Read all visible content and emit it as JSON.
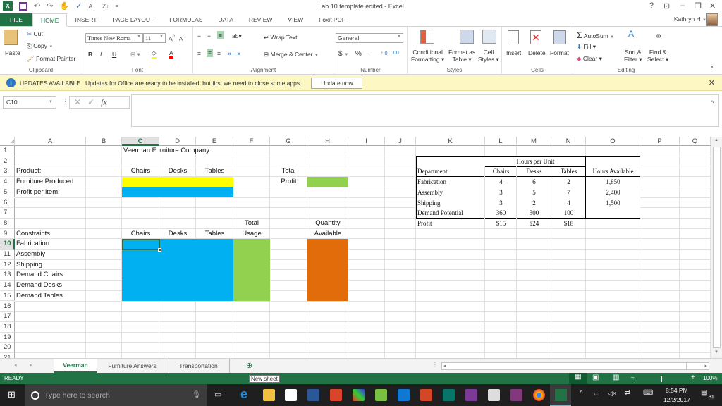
{
  "window": {
    "title": "Lab 10 template edited - Excel",
    "help": "?",
    "controls": [
      "ribbon-display-options",
      "minimize",
      "restore",
      "close"
    ]
  },
  "ribbon_tabs": [
    "FILE",
    "HOME",
    "INSERT",
    "PAGE LAYOUT",
    "FORMULAS",
    "DATA",
    "REVIEW",
    "VIEW",
    "Foxit PDF"
  ],
  "active_tab": "HOME",
  "user": "Kathryn H",
  "ribbon": {
    "clipboard": {
      "label": "Clipboard",
      "paste": "Paste",
      "cut": "Cut",
      "copy": "Copy",
      "format_painter": "Format Painter"
    },
    "font": {
      "label": "Font",
      "font_name": "Times New Roma",
      "font_size": "11",
      "bold": "B",
      "italic": "I",
      "underline": "U",
      "fill_color": "#ffff00",
      "font_color": "#ff0000"
    },
    "alignment": {
      "label": "Alignment",
      "wrap_text": "Wrap Text",
      "merge_center": "Merge & Center"
    },
    "number": {
      "label": "Number",
      "format": "General",
      "currency": "$",
      "percent": "%",
      "comma": ","
    },
    "styles": {
      "label": "Styles",
      "conditional": "Conditional",
      "conditional2": "Formatting",
      "format_as": "Format as",
      "format_as2": "Table",
      "cell": "Cell",
      "cell2": "Styles"
    },
    "cells": {
      "label": "Cells",
      "insert": "Insert",
      "delete": "Delete",
      "format": "Format"
    },
    "editing": {
      "label": "Editing",
      "autosum": "AutoSum",
      "fill": "Fill",
      "clear": "Clear",
      "sort": "Sort &",
      "sort2": "Filter",
      "find": "Find &",
      "find2": "Select"
    }
  },
  "update_bar": {
    "title": "UPDATES AVAILABLE",
    "message": "Updates for Office are ready to be installed, but first we need to close some apps.",
    "button": "Update now"
  },
  "formula_bar": {
    "name_box": "C10",
    "fx": "fx",
    "formula": ""
  },
  "columns": [
    "A",
    "B",
    "C",
    "D",
    "E",
    "F",
    "G",
    "H",
    "I",
    "J",
    "K",
    "L",
    "M",
    "N",
    "O",
    "P",
    "Q"
  ],
  "selected_column": "C",
  "rows": [
    "1",
    "2",
    "3",
    "4",
    "5",
    "6",
    "7",
    "8",
    "9",
    "10",
    "11",
    "12",
    "13",
    "14",
    "15",
    "16",
    "17",
    "18",
    "19",
    "20",
    "21"
  ],
  "selected_row": "10",
  "cells": {
    "C1": "Veerman Furniture Company",
    "A3": "Product:",
    "C3": "Chairs",
    "D3": "Desks",
    "E3": "Tables",
    "G3": "Total",
    "A4": "Furniture Produced",
    "G4": "Profit",
    "A5": "Profit per item",
    "F8": "Total",
    "H8": "Quantity",
    "A9": "Constraints",
    "C9": "Chairs",
    "D9": "Desks",
    "E9": "Tables",
    "F9": "Usage",
    "H9": "Available",
    "A10": "Fabrication",
    "A11": "Assembly",
    "A12": "Shipping",
    "A13": "Demand Chairs",
    "A14": "Demand Desks",
    "A15": "Demand Tables"
  },
  "fill_colors": {
    "yellow": "#ffff00",
    "blue": "#00b0f0",
    "green": "#92d050",
    "orange": "#e26b0a"
  },
  "reference_table": {
    "group_header": "Hours per Unit",
    "headers": [
      "Department",
      "Chairs",
      "Desks",
      "Tables",
      "Hours Available"
    ],
    "rows": [
      [
        "Fabrication",
        "4",
        "6",
        "2",
        "1,850"
      ],
      [
        "Assembly",
        "3",
        "5",
        "7",
        "2,400"
      ],
      [
        "Shipping",
        "3",
        "2",
        "4",
        "1,500"
      ],
      [
        "Demand Potential",
        "360",
        "300",
        "100",
        ""
      ],
      [
        "Profit",
        "$15",
        "$24",
        "$18",
        ""
      ]
    ]
  },
  "sheet_tabs": [
    "Veerman",
    "Furniture Answers",
    "Transportation"
  ],
  "active_sheet": "Veerman",
  "new_sheet_tooltip": "New sheet",
  "status": {
    "mode": "READY",
    "zoom": "100%"
  },
  "taskbar": {
    "search_placeholder": "Type here to search",
    "time": "8:54 PM",
    "date": "12/2/2017",
    "notifications": "31"
  }
}
